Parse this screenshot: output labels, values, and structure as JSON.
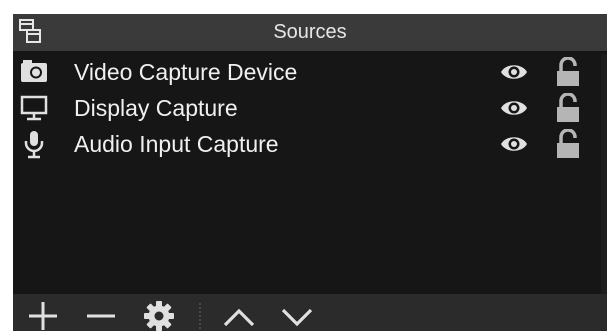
{
  "panel": {
    "title": "Sources",
    "title_icon": "undock-panel-icon"
  },
  "sources": [
    {
      "label": "Video Capture Device",
      "icon": "camera-icon",
      "visible": true,
      "locked": false
    },
    {
      "label": "Display Capture",
      "icon": "monitor-icon",
      "visible": true,
      "locked": false
    },
    {
      "label": "Audio Input Capture",
      "icon": "microphone-icon",
      "visible": true,
      "locked": false
    }
  ],
  "toolbar": {
    "buttons": [
      "add-icon",
      "remove-icon",
      "gear-icon",
      "move-up-icon",
      "move-down-icon"
    ]
  },
  "colors": {
    "panel_bg": "#161616",
    "titlebar_bg": "#3a3a3a",
    "toolbar_bg": "#2b2b2b",
    "text": "#f0f0f0",
    "icon": "#e0e0e0",
    "lock": "#b5b5b5"
  }
}
